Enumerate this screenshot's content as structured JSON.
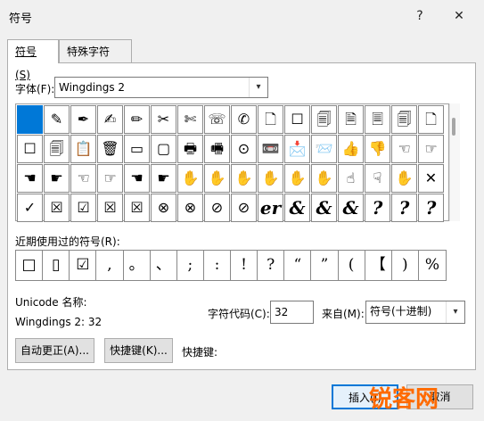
{
  "window": {
    "title": "符号",
    "help_glyph": "?",
    "close_glyph": "✕"
  },
  "tabs": [
    {
      "label": "符号(S)"
    },
    {
      "label": "特殊字符(P)"
    }
  ],
  "font": {
    "label": "字体(F):",
    "value": "Wingdings 2"
  },
  "symbol_grid": {
    "rows": [
      [
        "",
        "✎",
        "✒",
        "✍",
        "✏",
        "✂",
        "✄",
        "☏",
        "✆",
        "🗋",
        "☐",
        "🗐",
        "🗎",
        "🗏",
        "🗐",
        "🗋"
      ],
      [
        "☐",
        "🗐",
        "📋",
        "🗑",
        "▭",
        "▢",
        "🖶",
        "🖷",
        "⊙",
        "📼",
        "📩",
        "📨",
        "👍",
        "👎",
        "☜",
        "☞"
      ],
      [
        "☚",
        "☛",
        "☜",
        "☞",
        "☚",
        "☛",
        "✋",
        "✋",
        "✋",
        "✋",
        "✋",
        "✋",
        "☝",
        "☟",
        "✋",
        "✕"
      ],
      [
        "✓",
        "☒",
        "☑",
        "☒",
        "☒",
        "⊗",
        "⊗",
        "⊘",
        "⊘",
        "er",
        "&",
        "&",
        "&",
        "?",
        "?",
        "?"
      ]
    ]
  },
  "recent": {
    "label": "近期使用过的符号(R):",
    "symbols": [
      "□",
      "▯",
      "☑",
      ",",
      "。",
      "、",
      ";",
      ":",
      "!",
      "?",
      "“",
      "”",
      "(",
      "【",
      ")",
      "%"
    ]
  },
  "unicode": {
    "name_label": "Unicode 名称:",
    "name_value": "Wingdings 2: 32"
  },
  "char_code": {
    "label": "字符代码(C):",
    "value": "32"
  },
  "from": {
    "label": "来自(M):",
    "value": "符号(十进制)"
  },
  "buttons": {
    "autocorrect": "自动更正(A)...",
    "shortcut_key": "快捷键(K)...",
    "shortcut_label": "快捷键:",
    "insert": "插入(I)",
    "cancel": "取消"
  },
  "watermark": "锐客网",
  "colors": {
    "selection": "#0078d7",
    "watermark": "#ff6a00"
  }
}
